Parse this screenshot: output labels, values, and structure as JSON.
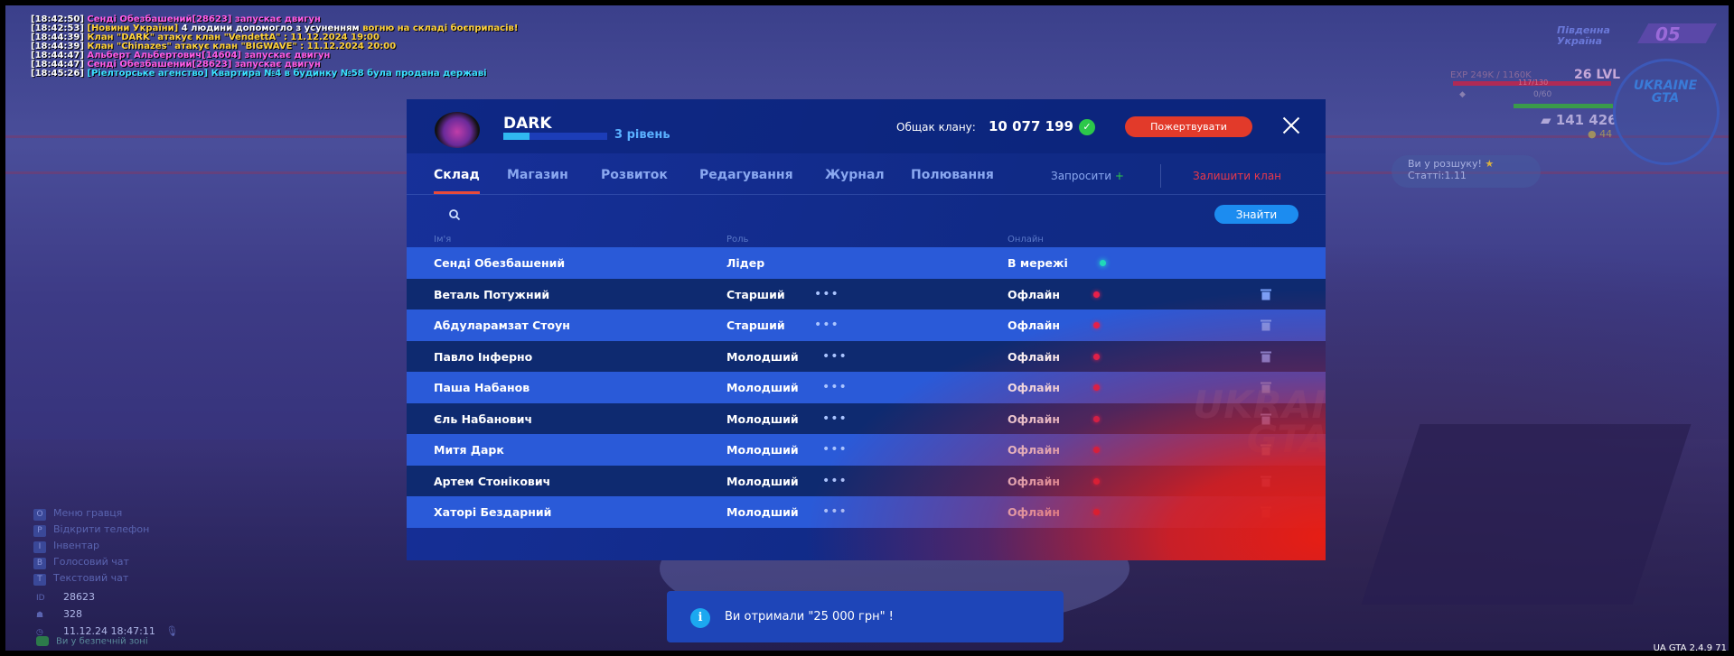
{
  "chat": [
    {
      "ts": "[18:42:50]",
      "parts": [
        {
          "text": "  Сенді Обезбашений[28623] запускає двигун",
          "color": "mag"
        }
      ]
    },
    {
      "ts": "[18:42:53]",
      "parts": [
        {
          "text": " [Новини України]",
          "color": "yel"
        },
        {
          "text": " 4 людини допомогло з усуненням ",
          "color": "wht"
        },
        {
          "text": "вогню на складі боєприпасів!",
          "color": "yel"
        }
      ]
    },
    {
      "ts": "[18:44:39]",
      "parts": [
        {
          "text": " Клан \"DARK\" атакує клан \"VendettA\" : 11.12.2024 19:00",
          "color": "yel"
        }
      ]
    },
    {
      "ts": "[18:44:39]",
      "parts": [
        {
          "text": " Клан \"Chinazes\" атакує клан \"BIGWAVE\" : 11.12.2024 20:00",
          "color": "yel"
        }
      ]
    },
    {
      "ts": "[18:44:47]",
      "parts": [
        {
          "text": "  Альберт Альбертович[14604] запускає двигун",
          "color": "mag"
        }
      ]
    },
    {
      "ts": "[18:44:47]",
      "parts": [
        {
          "text": "  Сенді Обезбашений[28623] запускає двигун",
          "color": "mag"
        }
      ]
    },
    {
      "ts": "[18:45:26]",
      "parts": [
        {
          "text": " [Ріелторське агенство] Квартира №4 в будинку №58 була продана державі",
          "color": "cyan"
        }
      ]
    }
  ],
  "hud": {
    "region_line1": "Південна",
    "region_line2": "Україна",
    "region_number": "05",
    "exp": "EXP 249K / 1160K",
    "level": "26 LVL",
    "health": "117/130",
    "armor": "0/60",
    "money": "141 426",
    "coins": "44",
    "minimap_logo_1": "UKRAINE",
    "minimap_logo_2": "GTA",
    "wanted_line1": "Ви у розшуку!",
    "wanted_line2": "Статті:1.11"
  },
  "clan": {
    "name": "DARK",
    "level_text": "3 рівень",
    "level_progress": 0.25,
    "bank_label": "Общак клану:",
    "bank_value": "10 077 199",
    "donate_label": "Пожертвувати",
    "tabs": [
      "Склад",
      "Магазин",
      "Розвиток",
      "Редагування",
      "Журнал",
      "Полювання"
    ],
    "active_tab": "Склад",
    "invite_label": "Запросити",
    "invite_plus": "+",
    "leave_label": "Залишити клан",
    "search_placeholder": "",
    "find_label": "Знайти",
    "columns": {
      "name": "Ім'я",
      "role": "Роль",
      "online": "Онлайн"
    },
    "members": [
      {
        "name": "Сенді Обезбашений",
        "role": "Лідер",
        "status": "В мережі",
        "online": true
      },
      {
        "name": "Веталь Потужний",
        "role": "Старший",
        "status": "Офлайн",
        "online": false
      },
      {
        "name": "Абдуларамзат Стоун",
        "role": "Старший",
        "status": "Офлайн",
        "online": false
      },
      {
        "name": "Павло Інферно",
        "role": "Молодший",
        "status": "Офлайн",
        "online": false
      },
      {
        "name": "Паша Набанов",
        "role": "Молодший",
        "status": "Офлайн",
        "online": false
      },
      {
        "name": "Єль Набанович",
        "role": "Молодший",
        "status": "Офлайн",
        "online": false
      },
      {
        "name": "Митя Дарк",
        "role": "Молодший",
        "status": "Офлайн",
        "online": false
      },
      {
        "name": "Артем Стонікович",
        "role": "Молодший",
        "status": "Офлайн",
        "online": false
      },
      {
        "name": "Хаторі Бездарний",
        "role": "Молодший",
        "status": "Офлайн",
        "online": false
      }
    ],
    "more_glyph": "•••",
    "watermark_1": "UKRAINE",
    "watermark_2": "GTA"
  },
  "hints": [
    {
      "key": "O",
      "label": "Меню гравця"
    },
    {
      "key": "P",
      "label": "Відкрити телефон"
    },
    {
      "key": "I",
      "label": "Інвентар"
    },
    {
      "key": "B",
      "label": "Голосовий чат"
    },
    {
      "key": "T",
      "label": "Текстовий чат"
    }
  ],
  "info": {
    "id_label": "ID",
    "id_value": "28623",
    "online_value": "328",
    "datetime": "11.12.24 18:47:11",
    "safe_zone": "Ви у безпечній зоні"
  },
  "notification": {
    "icon": "i",
    "text": "Ви отримали \"25 000 грн\" !"
  },
  "version": "UA GTA 2.4.9    71",
  "colors": {
    "panel_light_row": "#2a5ad8",
    "panel_dark_row": "#0e2a70",
    "accent_red": "#e23a2a",
    "accent_blue": "#1c8cf0",
    "online_dot": "#20d8b8",
    "offline_dot": "#e8204a"
  }
}
